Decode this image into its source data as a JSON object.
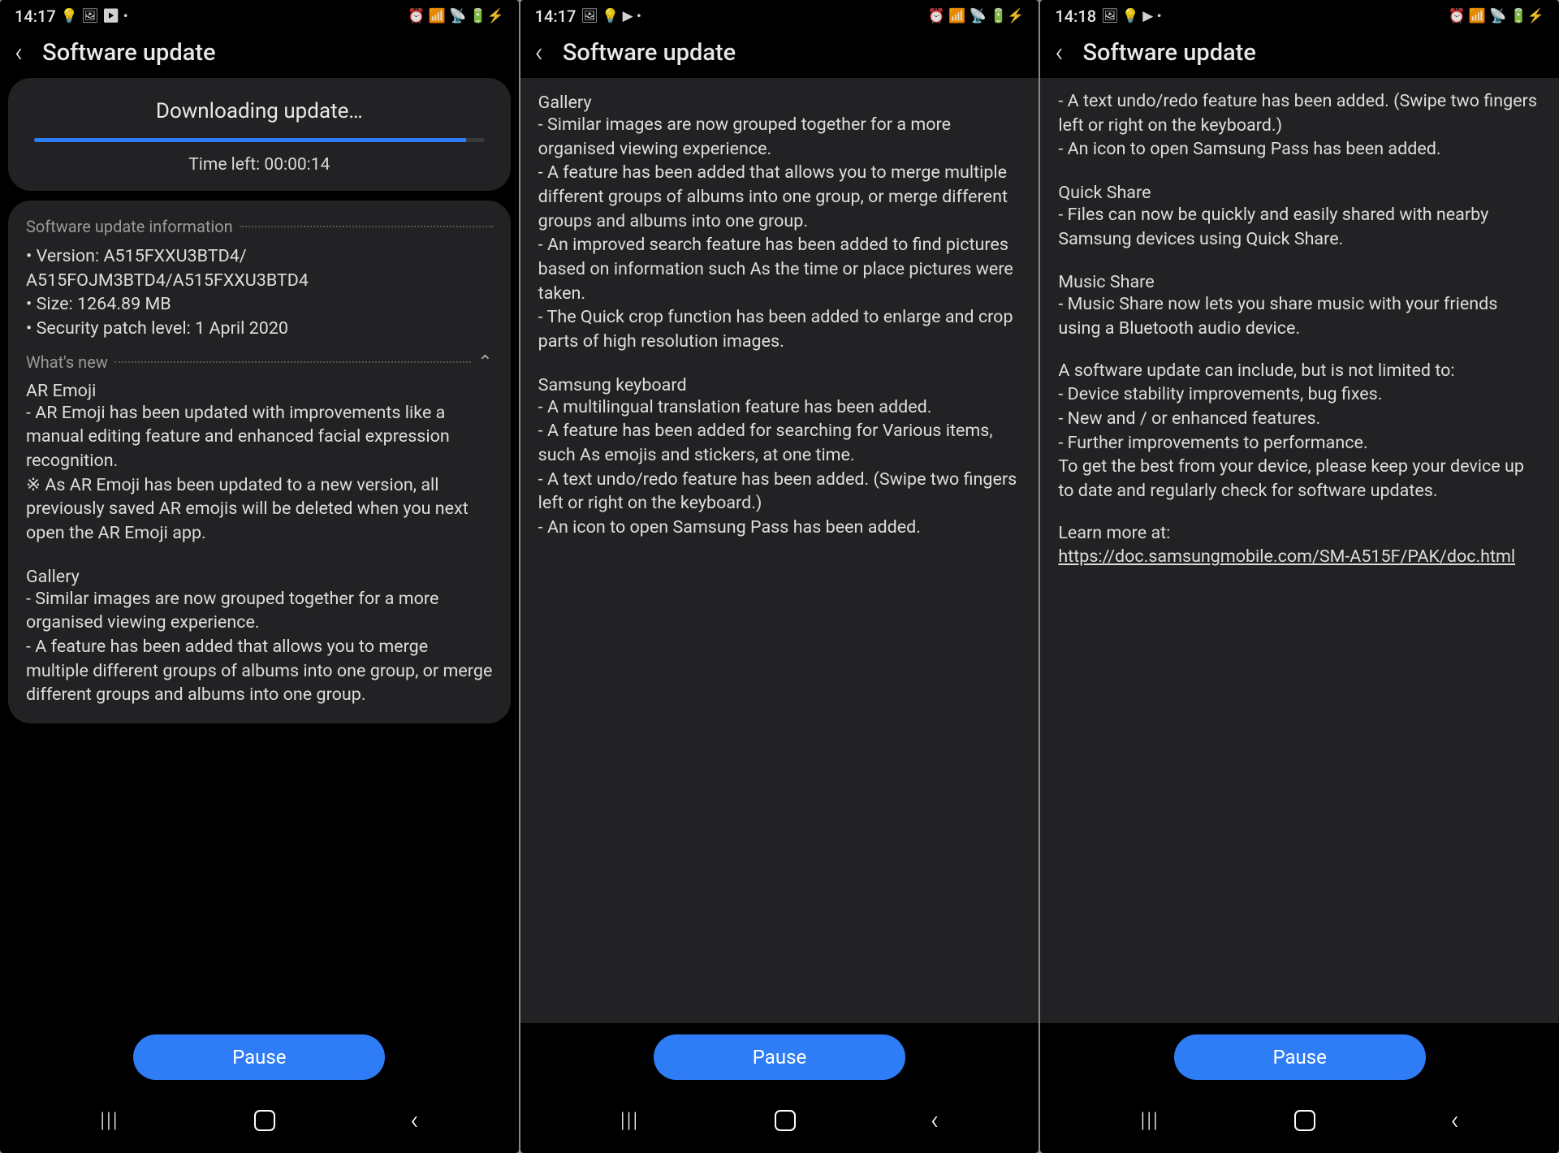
{
  "phones": [
    {
      "status": {
        "time": "14:17",
        "left_icons": "💡 🖼 ▶ •",
        "right_icons": "⏰ 📶 📡 🔋⚡"
      },
      "header": "Software update",
      "download": {
        "title": "Downloading update…",
        "time_left": "Time left: 00:00:14"
      },
      "info": {
        "header": "Software update information",
        "lines": [
          "• Version: A515FXXU3BTD4/",
          "  A515FOJM3BTD4/A515FXXU3BTD4",
          "• Size: 1264.89 MB",
          "• Security patch level: 1 April 2020"
        ]
      },
      "whatsnew": {
        "header": "What's new",
        "sections": [
          {
            "title": "AR Emoji",
            "body": "- AR Emoji has been updated with improvements like a manual editing feature and enhanced facial expression recognition.\n※ As AR Emoji has been updated to a new version, all previously saved AR emojis will be deleted when you next open the AR Emoji app."
          },
          {
            "title": "Gallery",
            "body": "- Similar images are now grouped together for a more organised viewing experience.\n- A feature has been added that allows you to merge multiple different groups of albums into one group, or merge different groups and albums into one group."
          }
        ]
      },
      "button": "Pause"
    },
    {
      "status": {
        "time": "14:17",
        "left_icons": "🖼 💡 ▶ •",
        "right_icons": "⏰ 📶 📡 🔋⚡"
      },
      "header": "Software update",
      "sections": [
        {
          "title": "Gallery",
          "body": "- Similar images are now grouped together for a more organised viewing experience.\n- A feature has been added that allows you to merge multiple different groups of albums into one group, or merge different groups and albums into one group.\n- An improved search feature has been added to find pictures based on information such As the time or place pictures were taken.\n- The Quick crop function has been added to enlarge and crop parts of high resolution images."
        },
        {
          "title": "Samsung keyboard",
          "body": "- A multilingual translation feature has been added.\n- A feature has been added for searching for Various items, such As emojis and stickers, at one time.\n- A text undo/redo feature has been added. (Swipe two fingers left or right on the keyboard.)\n- An icon to open Samsung Pass has been added."
        }
      ],
      "button": "Pause"
    },
    {
      "status": {
        "time": "14:18",
        "left_icons": "🖼 💡 ▶ •",
        "right_icons": "⏰ 📶 📡 🔋⚡"
      },
      "header": "Software update",
      "top_body": "- A text undo/redo feature has been added. (Swipe two fingers left or right on the keyboard.)\n- An icon to open Samsung Pass has been added.",
      "sections": [
        {
          "title": "Quick Share",
          "body": "- Files can now be quickly and easily shared with nearby Samsung devices using Quick Share."
        },
        {
          "title": "Music Share",
          "body": "- Music Share now lets you share music with your friends using a Bluetooth audio device."
        }
      ],
      "footer_body": "A software update can include, but is not limited to:\n - Device stability improvements, bug fixes.\n - New and / or enhanced features.\n - Further improvements to performance.\nTo get the best from your device, please keep your device up to date and regularly check for software updates.",
      "learn_more": "Learn more at:",
      "link": "https://doc.samsungmobile.com/SM-A515F/PAK/doc.html",
      "button": "Pause"
    }
  ]
}
